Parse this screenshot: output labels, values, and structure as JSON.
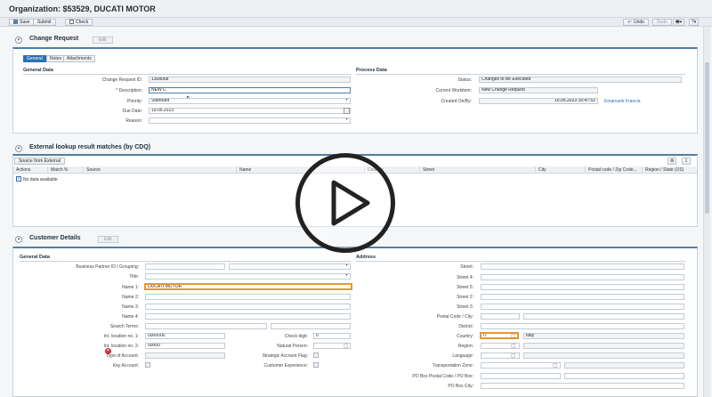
{
  "page_title": "Organization: $53529, DUCATI MOTOR",
  "toolbar": {
    "save": "Save",
    "submit": "Submit",
    "check": "Check",
    "undo": "Undo",
    "redo": "Redo"
  },
  "change_request": {
    "title": "Change Request",
    "edit": "Edit",
    "tabs": [
      "General",
      "Notes",
      "Attachments"
    ],
    "general_data_title": "General Data",
    "process_data_title": "Process Data",
    "fields": {
      "change_request_id": {
        "label": "Change Request ID:",
        "value": "1308068"
      },
      "description": {
        "label": "* Description:",
        "value": "NEW C"
      },
      "priority": {
        "label": "Priority:",
        "value": "Standard"
      },
      "due_date": {
        "label": "Due Date:",
        "value": "19.05.2023"
      },
      "reason": {
        "label": "Reason:",
        "value": ""
      },
      "status": {
        "label": "Status:",
        "value": "Changes to Be Executed"
      },
      "current_workitem": {
        "label": "Current Workitem:",
        "value": "New Change Request"
      },
      "created_on_by": {
        "label": "Created On/By:",
        "value": "16.05.2023 16:47:52",
        "user": "Emanuele Francia"
      }
    }
  },
  "external_lookup": {
    "title": "External lookup result matches (by CDQ)",
    "source_button": "Source from External",
    "columns": [
      "Actions",
      "Match %",
      "Source",
      "Name",
      "Country",
      "Street",
      "City",
      "Postal code / Zip Code...",
      "Region / State (US)"
    ],
    "empty_text": "No data available"
  },
  "customer_details": {
    "title": "Customer Details",
    "edit": "Edit",
    "general_data_title": "General Data",
    "address_title": "Address",
    "left_fields": {
      "bp_grouping": {
        "label": "Business Partner ID / Grouping:",
        "value": ""
      },
      "title": {
        "label": "Title:",
        "value": ""
      },
      "name1": {
        "label": "Name 1:",
        "value": "DUCATI MOTOR"
      },
      "name2": {
        "label": "Name 2:",
        "value": ""
      },
      "name3": {
        "label": "Name 3:",
        "value": ""
      },
      "name4": {
        "label": "Name 4:",
        "value": ""
      },
      "search_terms": {
        "label": "Search Terms:",
        "value": ""
      },
      "int_loc1": {
        "label": "Int. location no. 1:",
        "value": "0000000"
      },
      "int_loc2": {
        "label": "Int. location no. 2:",
        "value": "00000"
      },
      "type_of_account": {
        "label": "Type of Account:",
        "value": ""
      },
      "key_account": {
        "label": "Key Account:",
        "value": ""
      },
      "check_digit": {
        "label": "Check digit:",
        "value": "0"
      },
      "natural_person": {
        "label": "Natural Person:",
        "value": ""
      },
      "strategic_account": {
        "label": "Strategic Account Flag:",
        "value": ""
      },
      "customer_experience": {
        "label": "Customer Experience:",
        "value": ""
      }
    },
    "address_fields": {
      "street": {
        "label": "Street:",
        "value": ""
      },
      "street4": {
        "label": "Street 4:",
        "value": ""
      },
      "street5": {
        "label": "Street 5:",
        "value": ""
      },
      "street2": {
        "label": "Street 2:",
        "value": ""
      },
      "street3": {
        "label": "Street 3:",
        "value": ""
      },
      "postal_city": {
        "label": "Postal Code / City:",
        "value": ""
      },
      "district": {
        "label": "District:",
        "value": ""
      },
      "country": {
        "label": "Country:",
        "code": "IT",
        "name": "Italy"
      },
      "region": {
        "label": "Region:",
        "value": ""
      },
      "language": {
        "label": "Language:",
        "value": ""
      },
      "transportation_zone": {
        "label": "Transportation Zone:",
        "value": ""
      },
      "po_box_postal": {
        "label": "PO Box Postal Code / PO Box:",
        "value": ""
      },
      "po_box_city": {
        "label": "PO Box City:",
        "value": ""
      }
    }
  },
  "colors": {
    "accent": "#4f7ea8",
    "highlight": "#e8982e",
    "error": "#d62b2b"
  }
}
